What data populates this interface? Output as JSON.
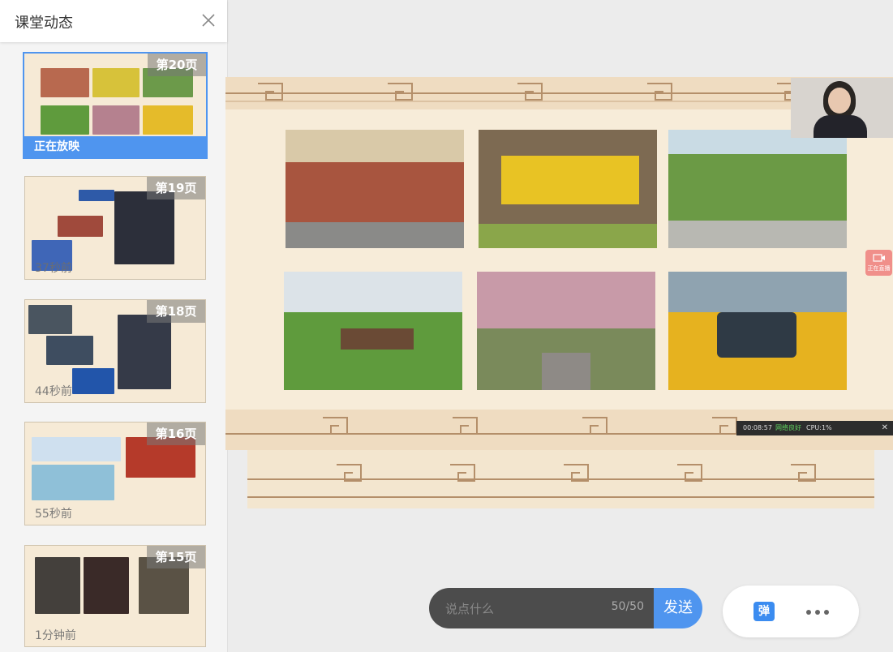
{
  "sidebar": {
    "title": "课堂动态",
    "thumbnails": [
      {
        "page": "第20页",
        "status": "正在放映",
        "active": true
      },
      {
        "page": "第19页",
        "time": "37秒前",
        "active": false
      },
      {
        "page": "第18页",
        "time": "44秒前",
        "active": false
      },
      {
        "page": "第16页",
        "time": "55秒前",
        "active": false
      },
      {
        "page": "第15页",
        "time": "1分钟前",
        "active": false
      }
    ]
  },
  "chat": {
    "placeholder": "说点什么",
    "count": "50/50",
    "send_label": "发送"
  },
  "tools": {
    "danmu_label": "弹"
  },
  "stage": {
    "status_time": "00:08:57",
    "status_net": "网络良好",
    "status_cpu": "CPU:1%",
    "live_label": "正在直播"
  },
  "icons": {
    "close": "close-icon",
    "more": "more-dots-icon",
    "danmu": "danmu-icon",
    "camera": "camera-icon"
  },
  "colors": {
    "accent": "#4f95ef",
    "chat_bg": "#4c4c4c",
    "slide_bg": "#f7ecd9"
  }
}
